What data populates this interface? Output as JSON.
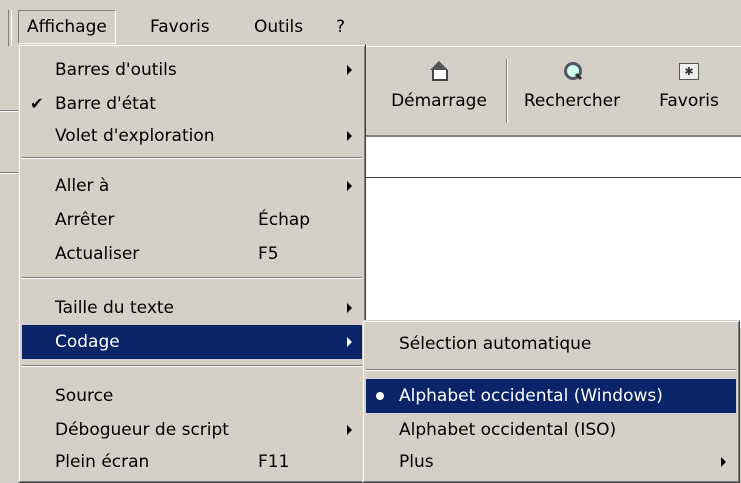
{
  "menubar": {
    "items": [
      "Affichage",
      "Favoris",
      "Outils",
      "?"
    ]
  },
  "toolbar": {
    "buttons": [
      {
        "label": "Démarrage",
        "icon": "home-icon"
      },
      {
        "label": "Rechercher",
        "icon": "search-icon"
      },
      {
        "label": "Favoris",
        "icon": "favorites-icon"
      }
    ]
  },
  "view_menu": {
    "items": [
      {
        "label": "Barres d'outils",
        "submenu": true
      },
      {
        "label": "Barre d'état",
        "checked": true
      },
      {
        "label": "Volet d'exploration",
        "submenu": true
      },
      {
        "label": "Aller à",
        "submenu": true
      },
      {
        "label": "Arrêter",
        "shortcut": "Échap"
      },
      {
        "label": "Actualiser",
        "shortcut": "F5"
      },
      {
        "label": "Taille du texte",
        "submenu": true
      },
      {
        "label": "Codage",
        "submenu": true,
        "highlighted": true
      },
      {
        "label": "Source"
      },
      {
        "label": "Débogueur de script",
        "submenu": true
      },
      {
        "label": "Plein écran",
        "shortcut": "F11"
      }
    ]
  },
  "encoding_menu": {
    "items": [
      {
        "label": "Sélection automatique"
      },
      {
        "label": "Alphabet occidental (Windows)",
        "selected": true,
        "highlighted": true
      },
      {
        "label": "Alphabet occidental (ISO)"
      },
      {
        "label": "Plus",
        "submenu": true
      }
    ]
  },
  "colors": {
    "face": "#d4d0c8",
    "highlight": "#0a246a"
  }
}
